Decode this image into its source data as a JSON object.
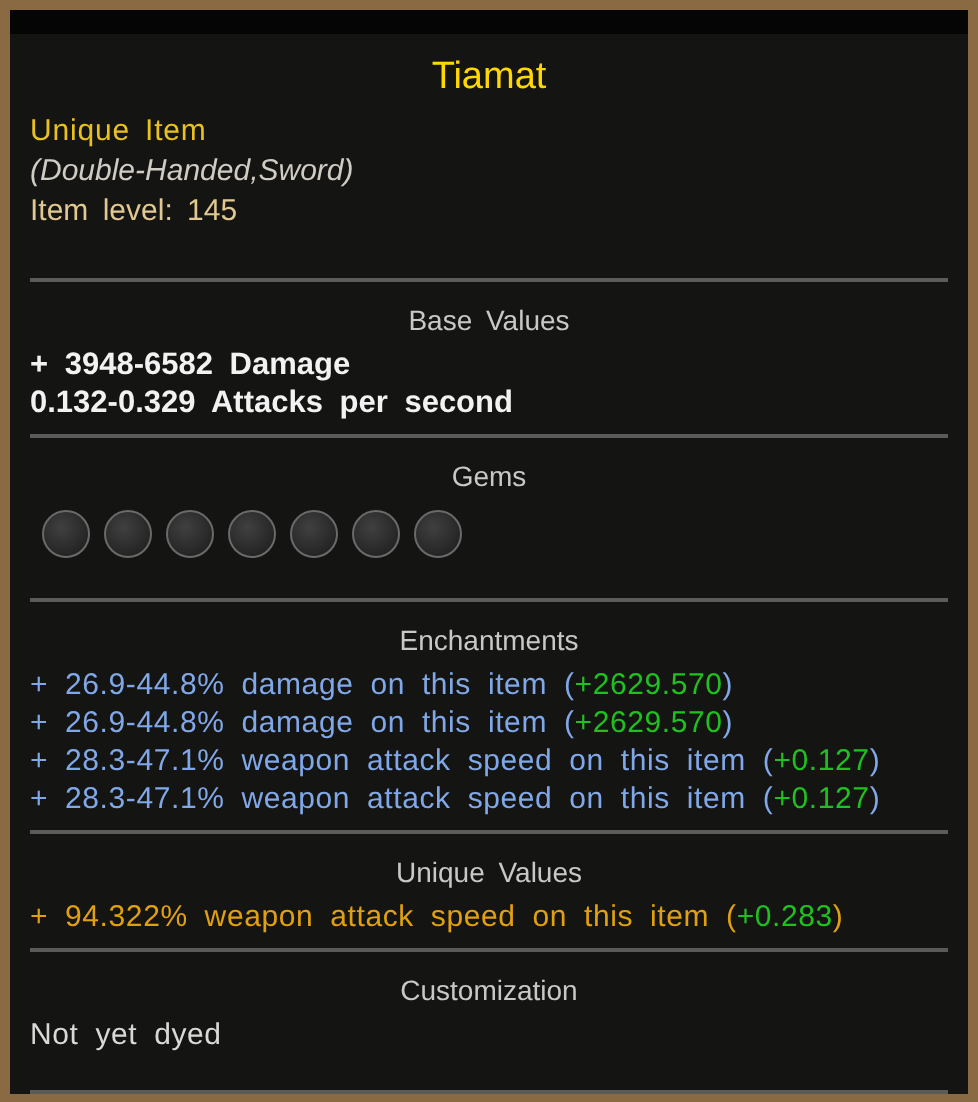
{
  "title": "Tiamat",
  "rarity": "Unique Item",
  "item_type": "(Double-Handed,Sword)",
  "item_level": "Item level: 145",
  "sections": [
    {
      "kind": "lines",
      "header": "Base Values",
      "lines": [
        {
          "text": "+ 3948-6582 Damage"
        },
        {
          "text": "0.132-0.329 Attacks per second"
        }
      ]
    },
    {
      "kind": "gems",
      "header": "Gems",
      "sockets": [
        {
          "filled": false
        },
        {
          "filled": false
        },
        {
          "filled": false
        },
        {
          "filled": false
        },
        {
          "filled": false
        },
        {
          "filled": false
        },
        {
          "filled": false
        }
      ]
    },
    {
      "kind": "enchant",
      "header": "Enchantments",
      "lines": [
        {
          "text": "+ 26.9-44.8% damage on this item (",
          "bonus": "+2629.570",
          "end": ")"
        },
        {
          "text": "+ 26.9-44.8% damage on this item (",
          "bonus": "+2629.570",
          "end": ")"
        },
        {
          "text": "+ 28.3-47.1% weapon attack speed on this item (",
          "bonus": "+0.127",
          "end": ")"
        },
        {
          "text": "+ 28.3-47.1% weapon attack speed on this item (",
          "bonus": "+0.127",
          "end": ")"
        }
      ]
    },
    {
      "kind": "unique",
      "header": "Unique Values",
      "lines": [
        {
          "text": "+ 94.322% weapon attack speed on this item (",
          "bonus": "+0.283",
          "end": ")"
        }
      ]
    },
    {
      "kind": "plain",
      "header": "Customization",
      "lines": [
        {
          "text": "Not yet dyed"
        }
      ]
    }
  ]
}
